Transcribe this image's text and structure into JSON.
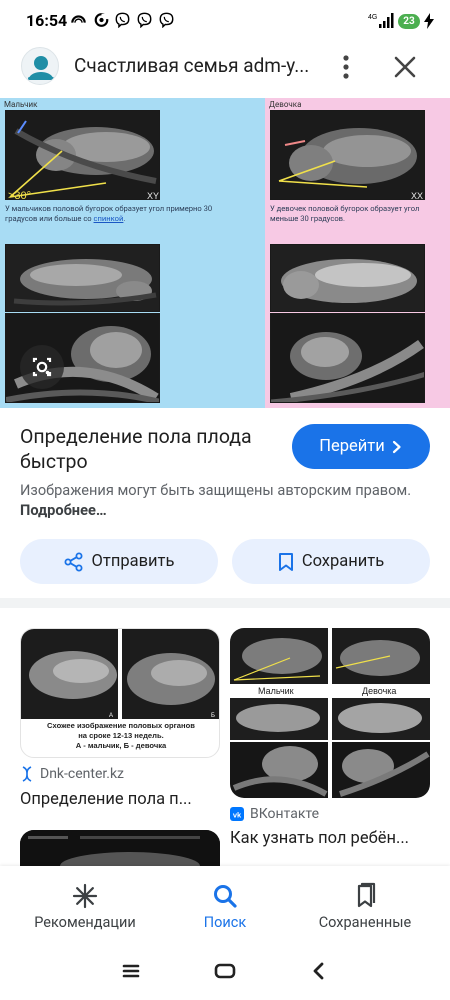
{
  "status_bar": {
    "time": "16:54",
    "network": "4G",
    "battery": "23"
  },
  "header": {
    "site_title": "Счастливая семья adm-у...",
    "menu_icon": "more-vert-icon",
    "close_icon": "close-icon"
  },
  "image": {
    "label_boy": "Мальчик",
    "label_girl": "Девочка",
    "angle_label": ">30°",
    "xy_label": "XY",
    "xx_label": "XX",
    "caption_boy_1": "У мальчиков половой бугорок образует угол примерно 30",
    "caption_boy_2": "градусов или больше со",
    "caption_boy_link": "спинкой",
    "caption_boy_end": ".",
    "caption_girl_1": "У девочек половой бугорок образует угол",
    "caption_girl_2": "меньше 30 градусов."
  },
  "result": {
    "title": "Определение пола плода быстро",
    "go_button": "Перейти",
    "copyright": "Изображения могут быть защищены авторским правом.",
    "more_link": "Подробнее…"
  },
  "actions": {
    "share": "Отправить",
    "save": "Сохранить"
  },
  "related": [
    {
      "source": "Dnk-center.kz",
      "title": "Определение пола п...",
      "caption_line1": "Схожее изображение половых органов",
      "caption_line2": "на сроке 12-13 недель.",
      "caption_line3": "А - мальчик, Б - девочка",
      "mark_a": "А",
      "mark_b": "Б"
    },
    {
      "source": "ВКонтакте",
      "title": "Как узнать пол ребён...",
      "label_boy": "Мальчик",
      "label_girl": "Девочка"
    }
  ],
  "bottom_nav": {
    "items": [
      {
        "label": "Рекомендации",
        "icon": "asterisk-icon"
      },
      {
        "label": "Поиск",
        "icon": "search-icon"
      },
      {
        "label": "Сохраненные",
        "icon": "bookmarks-icon"
      }
    ],
    "active": "Поиск"
  },
  "colors": {
    "accent": "#1a73e8",
    "pill": "#e8f0fe",
    "boy_panel": "#a8dcf4",
    "girl_panel": "#f7c9e4",
    "battery": "#4caf50"
  }
}
